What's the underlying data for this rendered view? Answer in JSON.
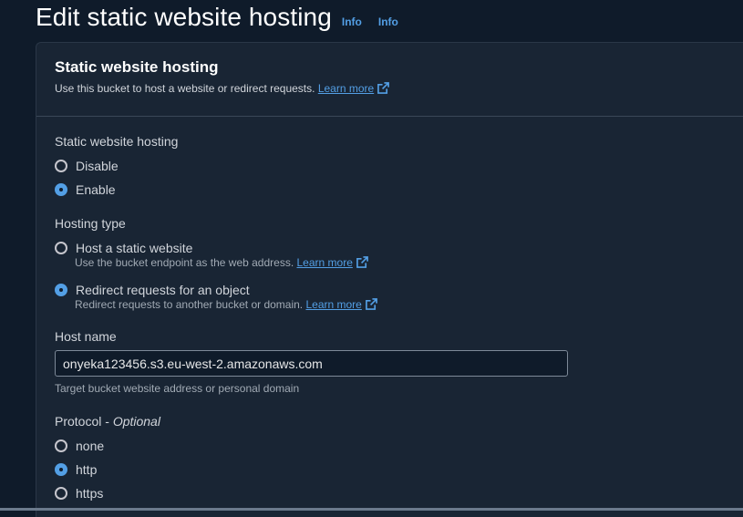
{
  "header": {
    "title": "Edit static website hosting",
    "info_1": "Info",
    "info_2": "Info"
  },
  "panel": {
    "title": "Static website hosting",
    "description": "Use this bucket to host a website or redirect requests.",
    "learn_more": "Learn more"
  },
  "hosting": {
    "label": "Static website hosting",
    "options": [
      "Disable",
      "Enable"
    ],
    "selected": "Enable"
  },
  "hosting_type": {
    "label": "Hosting type",
    "options": [
      {
        "label": "Host a static website",
        "description": "Use the bucket endpoint as the web address.",
        "learn_more": "Learn more"
      },
      {
        "label": "Redirect requests for an object",
        "description": "Redirect requests to another bucket or domain.",
        "learn_more": "Learn more"
      }
    ],
    "selected": "Redirect requests for an object"
  },
  "host_name": {
    "label": "Host name",
    "value": "onyeka123456.s3.eu-west-2.amazonaws.com",
    "hint": "Target bucket website address or personal domain"
  },
  "protocol": {
    "label": "Protocol - ",
    "label_optional": "Optional",
    "options": [
      "none",
      "http",
      "https"
    ],
    "selected": "http"
  },
  "colors": {
    "accent": "#539fe5",
    "background": "#0f1b2a",
    "panel": "#192534"
  }
}
